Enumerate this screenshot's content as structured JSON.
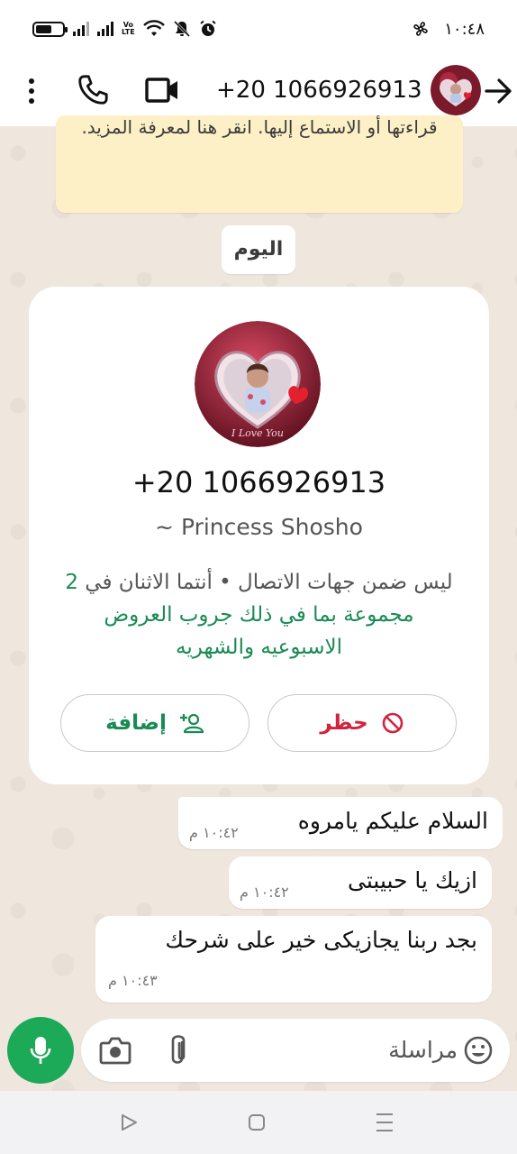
{
  "status_bar": {
    "time": "١٠:٤٨",
    "volte_label": "Vo\nLTE",
    "icons": [
      "battery-icon",
      "signal-icon",
      "signal-icon",
      "volte-icon",
      "wifi-icon",
      "mute-icon",
      "alarm-icon",
      "pinwheel-icon"
    ]
  },
  "header": {
    "title": "+20 1066926913",
    "icons": [
      "more-vertical-icon",
      "phone-icon",
      "video-icon",
      "avatar",
      "back-arrow-icon"
    ]
  },
  "notice": {
    "text": "قراءتها أو الاستماع إليها. انقر هنا لمعرفة المزيد."
  },
  "date_chip": "اليوم",
  "contact_card": {
    "phone": "+20 1066926913",
    "name": "~ Princess Shosho",
    "desc_plain": "ليس ضمن جهات الاتصال • أنتما الاثنان في",
    "desc_link": "2 مجموعة بما في ذلك جروب العروض الاسبوعيه والشهريه",
    "block_label": "حظر",
    "add_label": "إضافة"
  },
  "messages": [
    {
      "text": "السلام عليكم يامروه",
      "time": "١٠:٤٢ م"
    },
    {
      "text": "ازيك يا حبيبتى",
      "time": "١٠:٤٢ م"
    },
    {
      "text": "بجد ربنا يجازيكى خير على شرحك",
      "time": "١٠:٤٣ م"
    }
  ],
  "composer": {
    "placeholder": "مراسلة",
    "icons": [
      "mic-icon",
      "camera-icon",
      "attach-icon",
      "emoji-icon"
    ]
  },
  "colors": {
    "accent_green": "#1ca958",
    "link_green": "#1a8a55",
    "block_red": "#d0233d",
    "notice_bg": "#fdf0c7",
    "chat_bg": "#efe7dd"
  }
}
